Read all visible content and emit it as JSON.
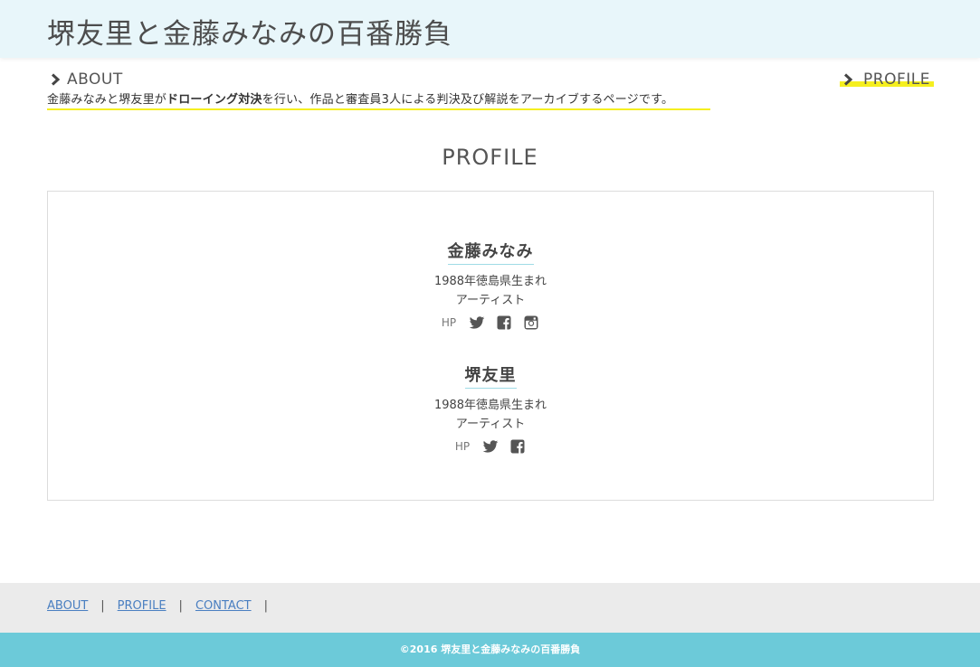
{
  "header": {
    "site_title": "堺友里と金藤みなみの百番勝負"
  },
  "nav": {
    "about_label": "ABOUT",
    "profile_label": "PROFILE"
  },
  "tagline": {
    "prefix": "金藤みなみと堺友里が",
    "bold": "ドローイング対決",
    "suffix": "を行い、作品と審査員3人による判決及び解説をアーカイブするページです。"
  },
  "section": {
    "title": "PROFILE"
  },
  "profiles": [
    {
      "name": "金藤みなみ",
      "birth": "1988年徳島県生まれ",
      "role": "アーティスト",
      "hp_label": "HP",
      "icons": [
        "twitter-icon",
        "facebook-icon",
        "instagram-icon"
      ]
    },
    {
      "name": "堺友里",
      "birth": "1988年徳島県生まれ",
      "role": "アーティスト",
      "hp_label": "HP",
      "icons": [
        "twitter-icon",
        "facebook-icon"
      ]
    }
  ],
  "footer": {
    "links": [
      "ABOUT",
      "PROFILE",
      "CONTACT"
    ],
    "separator": "|",
    "copyright": "©2016 堺友里と金藤みなみの百番勝負"
  },
  "colors": {
    "header_bg": "#e8f6fa",
    "highlight": "#f5ef1f",
    "footer_bg": "#ebebeb",
    "copyright_bg": "#6ccad9",
    "link": "#4a7fc1"
  }
}
